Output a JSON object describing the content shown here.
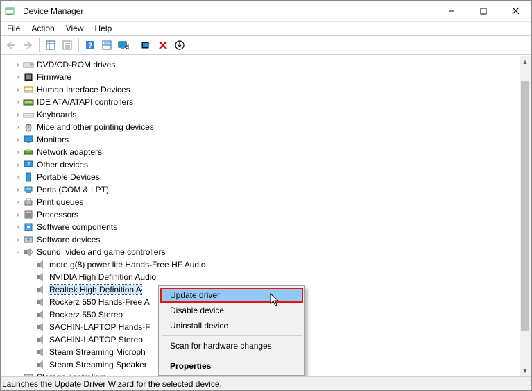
{
  "window": {
    "title": "Device Manager"
  },
  "menu": {
    "file": "File",
    "action": "Action",
    "view": "View",
    "help": "Help"
  },
  "tree": {
    "dvd": "DVD/CD-ROM drives",
    "firmware": "Firmware",
    "hid": "Human Interface Devices",
    "ide": "IDE ATA/ATAPI controllers",
    "keyboards": "Keyboards",
    "mice": "Mice and other pointing devices",
    "monitors": "Monitors",
    "network": "Network adapters",
    "other": "Other devices",
    "portable": "Portable Devices",
    "ports": "Ports (COM & LPT)",
    "printq": "Print queues",
    "processors": "Processors",
    "swcomp": "Software components",
    "swdev": "Software devices",
    "sound": "Sound, video and game controllers",
    "storage": "Storage controllers",
    "children": {
      "moto": "moto g(8) power lite Hands-Free HF Audio",
      "nvidia": "NVIDIA High Definition Audio",
      "realtek": "Realtek High Definition A",
      "rockerz_hf": "Rockerz 550 Hands-Free A",
      "rockerz_st": "Rockerz 550 Stereo",
      "sachin_hf": "SACHIN-LAPTOP Hands-F",
      "sachin_st": "SACHIN-LAPTOP Stereo",
      "steam_mic": "Steam Streaming Microph",
      "steam_spk": "Steam Streaming Speaker"
    }
  },
  "context": {
    "update": "Update driver",
    "disable": "Disable device",
    "uninstall": "Uninstall device",
    "scan": "Scan for hardware changes",
    "properties": "Properties"
  },
  "status": "Launches the Update Driver Wizard for the selected device."
}
